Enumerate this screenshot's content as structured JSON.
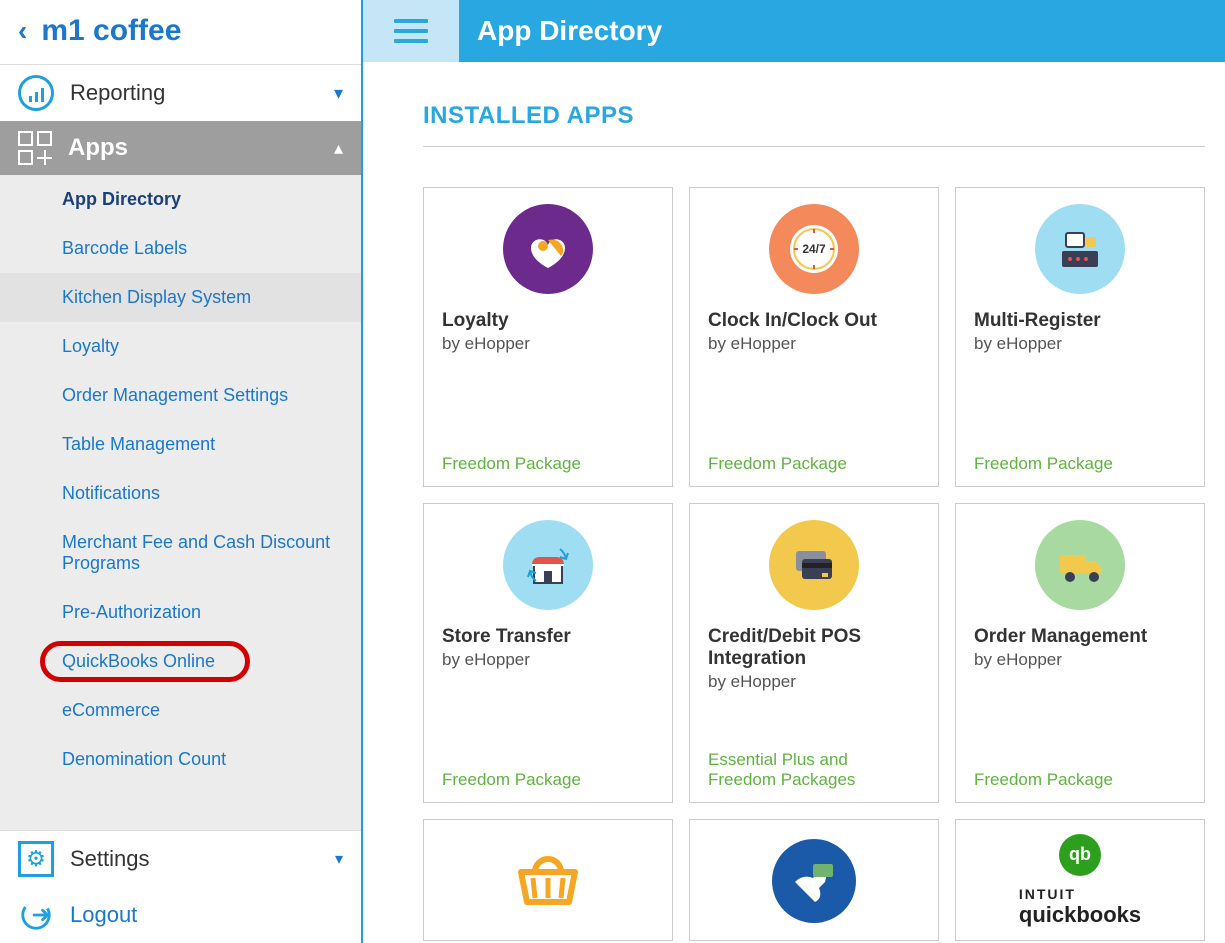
{
  "sidebar": {
    "brand": "m1 coffee",
    "nav": {
      "reporting": "Reporting",
      "apps": "Apps",
      "settings": "Settings",
      "logout": "Logout"
    },
    "sub": [
      "App Directory",
      "Barcode Labels",
      "Kitchen Display System",
      "Loyalty",
      "Order Management Settings",
      "Table Management",
      "Notifications",
      "Merchant Fee and Cash Discount Programs",
      "Pre-Authorization",
      "QuickBooks Online",
      "eCommerce",
      "Denomination Count"
    ]
  },
  "topbar": {
    "title": "App Directory"
  },
  "section": {
    "heading": "INSTALLED APPS"
  },
  "cards": [
    {
      "title": "Loyalty",
      "vendor": "by eHopper",
      "package": "Freedom Package"
    },
    {
      "title": "Clock In/Clock Out",
      "vendor": "by eHopper",
      "package": "Freedom Package"
    },
    {
      "title": "Multi-Register",
      "vendor": "by eHopper",
      "package": "Freedom Package"
    },
    {
      "title": "Store Transfer",
      "vendor": "by eHopper",
      "package": "Freedom Package"
    },
    {
      "title": "Credit/Debit POS Integration",
      "vendor": "by eHopper",
      "package": "Essential Plus and Freedom Packages"
    },
    {
      "title": "Order Management",
      "vendor": "by eHopper",
      "package": "Freedom Package"
    }
  ],
  "qb": {
    "brand_top": "INTUIT",
    "brand_bottom": "quickbooks"
  }
}
